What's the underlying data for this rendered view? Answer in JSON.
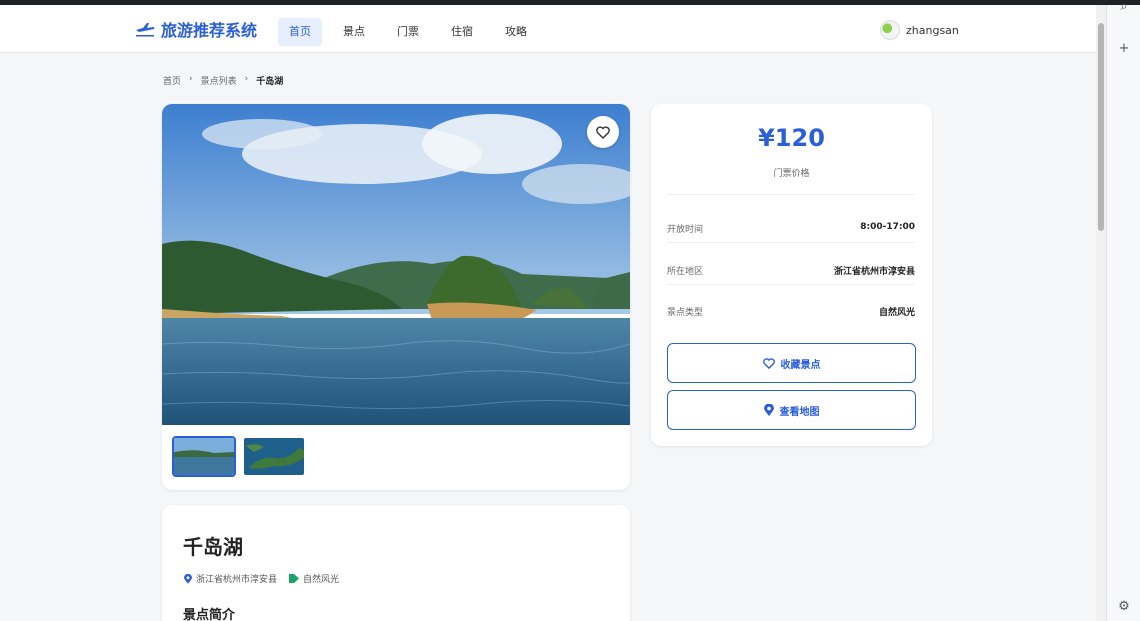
{
  "nav": {
    "logo": "旅游推荐系统",
    "items": [
      "首页",
      "景点",
      "门票",
      "住宿",
      "攻略"
    ],
    "user": "zhangsan"
  },
  "breadcrumb": [
    "首页",
    "景点列表",
    "千岛湖"
  ],
  "info": {
    "price": "¥120",
    "price_label": "门票价格",
    "rows": [
      {
        "k": "开放时间",
        "v": "8:00-17:00"
      },
      {
        "k": "所在地区",
        "v": "浙江省杭州市淳安县"
      },
      {
        "k": "景点类型",
        "v": "自然风光"
      }
    ],
    "fav_button": "收藏景点",
    "map_button": "查看地图"
  },
  "detail": {
    "title": "千岛湖",
    "location": "浙江省杭州市淳安县",
    "category": "自然风光",
    "section_title": "景点简介"
  },
  "sidebar": {
    "add": "+"
  },
  "colors": {
    "accent": "#2b5fd9",
    "background": "#f5f6f8"
  }
}
